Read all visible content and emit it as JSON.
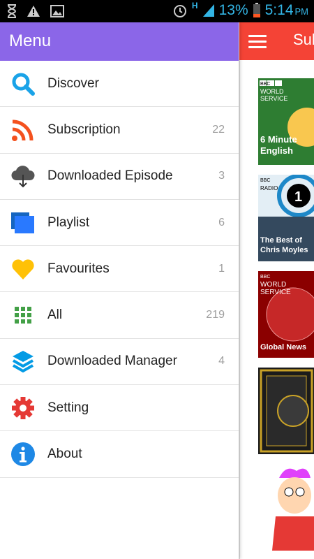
{
  "status_bar": {
    "battery_percent": "13%",
    "time": "5:14",
    "ampm": "PM",
    "network": "H",
    "accent_color": "#33b5e5"
  },
  "drawer": {
    "title": "Menu",
    "header_color": "#8b66e8",
    "items": [
      {
        "label": "Discover",
        "count": "",
        "icon": "search-icon"
      },
      {
        "label": "Subscription",
        "count": "22",
        "icon": "rss-icon"
      },
      {
        "label": "Downloaded Episode",
        "count": "3",
        "icon": "cloud-download-icon"
      },
      {
        "label": "Playlist",
        "count": "6",
        "icon": "playlist-icon"
      },
      {
        "label": "Favourites",
        "count": "1",
        "icon": "heart-icon"
      },
      {
        "label": "All",
        "count": "219",
        "icon": "grid-icon"
      },
      {
        "label": "Downloaded Manager",
        "count": "4",
        "icon": "layers-icon"
      },
      {
        "label": "Setting",
        "count": "",
        "icon": "gear-icon"
      },
      {
        "label": "About",
        "count": "",
        "icon": "info-icon"
      }
    ]
  },
  "content": {
    "title": "Sub",
    "bar_color": "#f44336",
    "thumbnails": [
      {
        "line1": "BBC",
        "line2": "WORLD",
        "line3": "SERVICE",
        "caption": "6 Minute English"
      },
      {
        "line1": "BBC",
        "line2": "RADIO",
        "line3": "1",
        "caption": "The Best of Chris Moyles"
      },
      {
        "line1": "BBC",
        "line2": "WORLD",
        "line3": "SERVICE",
        "caption": "Global News"
      },
      {
        "line1": "",
        "line2": "",
        "line3": "",
        "caption": ""
      },
      {
        "line1": "",
        "line2": "",
        "line3": "",
        "caption": ""
      }
    ]
  }
}
